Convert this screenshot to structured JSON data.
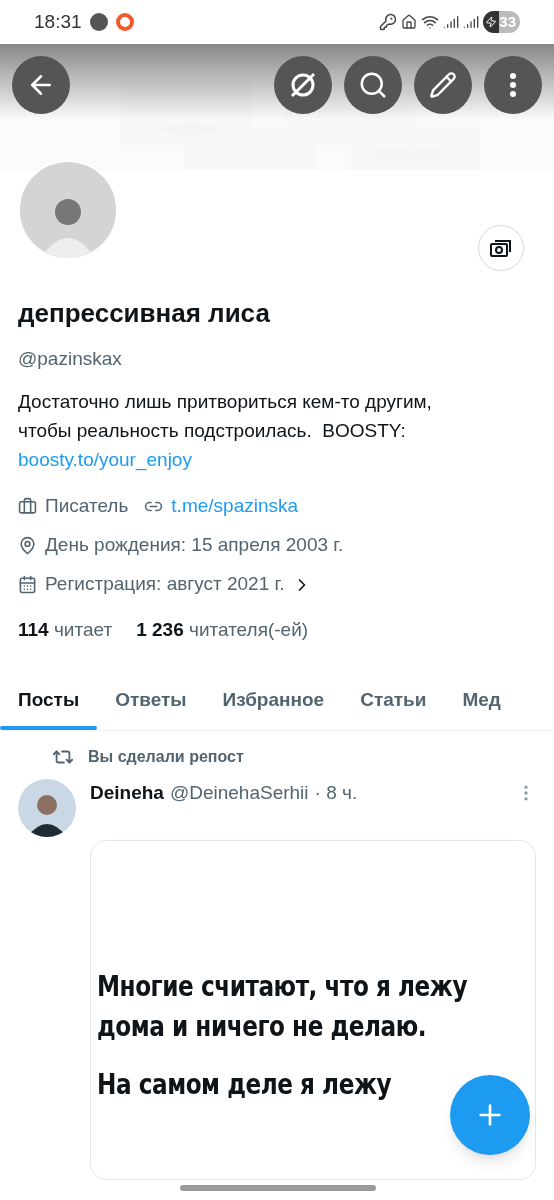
{
  "status_bar": {
    "time": "18:31",
    "battery": "33"
  },
  "profile": {
    "name": "депрессивная лиса",
    "handle": "@pazinskax",
    "bio": "Достаточно лишь притвориться кем-то другим, чтобы реальность подстроилась.  BOOSTY:",
    "bio_link": "boosty.to/your_enjoy",
    "meta": [
      {
        "kind": "job",
        "text": "Писатель",
        "link": "t.me/spazinska"
      },
      {
        "kind": "birthday",
        "text": "День рождения: 15 апреля 2003 г."
      },
      {
        "kind": "joined",
        "text": "Регистрация: август 2021 г."
      }
    ],
    "stats": [
      {
        "count": "114",
        "label": "читает"
      },
      {
        "count": "1 236",
        "label": "читателя(-ей)"
      }
    ]
  },
  "tabs": [
    {
      "label": "Посты",
      "selected": true
    },
    {
      "label": "Ответы",
      "selected": false
    },
    {
      "label": "Избранное",
      "selected": false
    },
    {
      "label": "Статьи",
      "selected": false
    },
    {
      "label": "Мед",
      "selected": false
    }
  ],
  "post": {
    "repost_note": "Вы сделали репост",
    "author": "Deineha",
    "handle": "@DeinehaSerhii",
    "time": "· 8 ч.",
    "image_lines": [
      "Многие считают, что я лежу дома и ничего не делаю.",
      "На самом деле я лежу"
    ]
  }
}
